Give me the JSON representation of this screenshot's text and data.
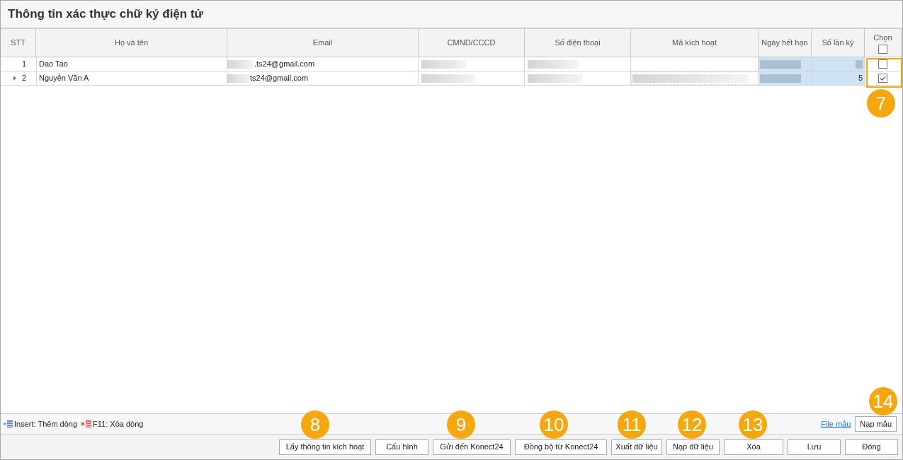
{
  "window": {
    "title": "Thông tin xác thực chữ ký điện tử"
  },
  "table": {
    "columns": [
      "STT",
      "Họ và tên",
      "Email",
      "CMND/CCCD",
      "Số điện thoại",
      "Mã kích hoạt",
      "Ngày hết hạn",
      "Số lần ký",
      "Chọn"
    ],
    "select_all": false,
    "rows": [
      {
        "stt": "1",
        "name": "Dao Tao",
        "email": ".ts24@gmail.com",
        "activation_code_hidden": false,
        "sign_count": "",
        "checked": false,
        "current": false
      },
      {
        "stt": "2",
        "name": "Nguyễn Văn A",
        "email": "ts24@gmail.com",
        "activation_code_hidden": true,
        "sign_count": "5",
        "checked": true,
        "current": true
      }
    ]
  },
  "hints": [
    {
      "kind": "insert",
      "text": "Insert: Thêm dòng"
    },
    {
      "kind": "delete",
      "text": "F11: Xóa dòng"
    }
  ],
  "template_link": "File mẫu",
  "template_button": "Nạp mẫu",
  "buttons": [
    "Lấy thông tin kích hoạt",
    "Cấu hình",
    "Gửi đến Konect24",
    "Đồng bộ từ Konect24",
    "Xuất dữ liệu",
    "Nạp dữ liệu",
    "Xóa",
    "Lưu",
    "Đóng"
  ],
  "callouts": [
    "7",
    "8",
    "9",
    "10",
    "11",
    "12",
    "13",
    "14"
  ]
}
